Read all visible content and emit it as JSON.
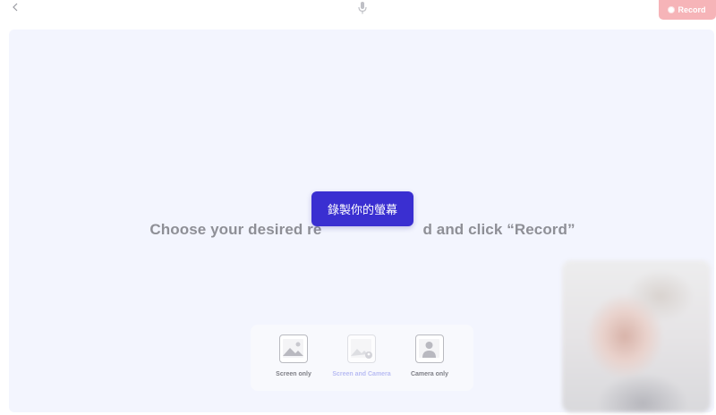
{
  "topbar": {
    "back_icon": "chevron-left-icon",
    "mic_icon": "microphone-icon",
    "record_label": "Record",
    "record_color": "#f6b4b8"
  },
  "main": {
    "instruction_before": "Choose your desired re",
    "instruction_after": "d and click “Record”",
    "background_color": "#f3f5fe"
  },
  "tooltip": {
    "text": "錄製你的螢幕",
    "color": "#3a2fd1"
  },
  "modes": [
    {
      "label": "Screen only",
      "icon": "image-icon",
      "enabled": true
    },
    {
      "label": "Screen and Camera",
      "icon": "image-with-person-icon",
      "enabled": false
    },
    {
      "label": "Camera only",
      "icon": "person-icon",
      "enabled": true
    }
  ]
}
